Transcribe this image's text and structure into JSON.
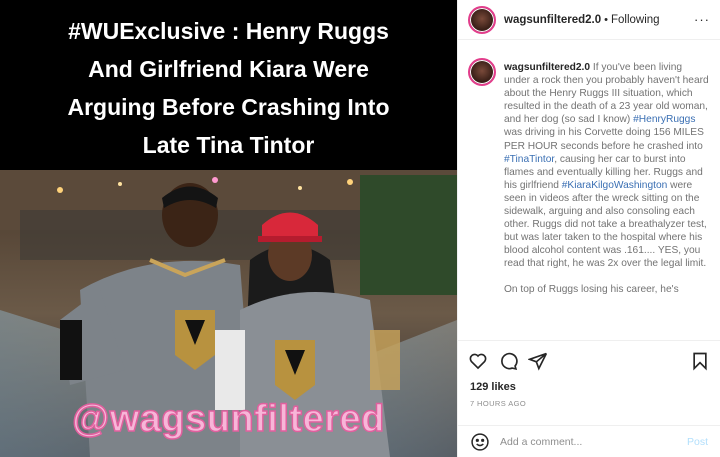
{
  "post": {
    "headline_lines": [
      "#WUExclusive : Henry Ruggs",
      "And Girlfriend Kiara Were",
      "Arguing Before Crashing Into",
      "Late Tina Tintor"
    ],
    "watermark": "@wagsunfiltered"
  },
  "header": {
    "username": "wagsunfiltered2.0",
    "separator": "•",
    "follow_status": "Following",
    "more": "···"
  },
  "caption": {
    "username": "wagsunfiltered2.0",
    "segments": [
      {
        "text": "If you've been living under a rock then you probably haven't heard about the Henry Ruggs III situation, which resulted in the death of a 23 year old woman, and her dog (so sad I know) ",
        "tag": false
      },
      {
        "text": "#HenryRuggs",
        "tag": true
      },
      {
        "text": " was driving in his Corvette doing 156 MILES PER HOUR seconds before he crashed into ",
        "tag": false
      },
      {
        "text": "#TinaTintor",
        "tag": true
      },
      {
        "text": ", causing her car to burst into flames and eventually killing her. Ruggs and his girlfriend ",
        "tag": false
      },
      {
        "text": "#KiaraKilgoWashington",
        "tag": true
      },
      {
        "text": " were seen in videos after the wreck sitting on the sidewalk, arguing and also consoling each other. Ruggs did not take a breathalyzer test, but was later taken to the hospital where his blood alcohol content was .161.... YES, you read that right, he was 2x over the legal limit.",
        "tag": false
      }
    ],
    "continuation": "On top of Ruggs losing his career, he's"
  },
  "actions": {
    "icons": [
      "heart-icon",
      "comment-icon",
      "share-icon",
      "bookmark-icon"
    ],
    "likes": "129 likes",
    "timestamp": "7 HOURS AGO"
  },
  "comment": {
    "placeholder": "Add a comment...",
    "post_label": "Post"
  },
  "colors": {
    "link": "#3a6fb3",
    "post_disabled": "#b2dffc",
    "watermark": "#f7b6d8"
  }
}
